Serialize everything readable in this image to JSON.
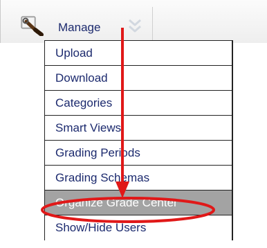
{
  "toolbar": {
    "manage_label": "Manage",
    "manage_icon": "wrench-icon",
    "dropdown_icon": "chevron-down-icon"
  },
  "menu": {
    "items": [
      {
        "label": "Upload",
        "highlighted": false
      },
      {
        "label": "Download",
        "highlighted": false
      },
      {
        "label": "Categories",
        "highlighted": false
      },
      {
        "label": "Smart Views",
        "highlighted": false
      },
      {
        "label": "Grading Periods",
        "highlighted": false
      },
      {
        "label": "Grading Schemas",
        "highlighted": false
      },
      {
        "label": "Organize Grade Center",
        "highlighted": true
      },
      {
        "label": "Show/Hide Users",
        "highlighted": false
      }
    ]
  },
  "annotation": {
    "arrow_color": "#e01818",
    "ellipse_color": "#e01818",
    "highlight_color": "#a3a3a3"
  }
}
